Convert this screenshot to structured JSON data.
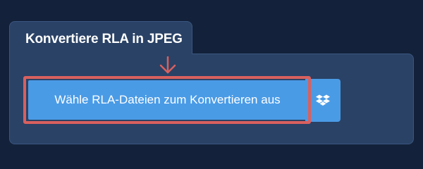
{
  "converter": {
    "tab_title": "Konvertiere RLA in JPEG",
    "choose_button_label": "Wähle RLA-Dateien zum Konvertieren aus",
    "dropbox_icon": "dropbox-icon",
    "highlight_arrow_icon": "arrow-down-icon"
  },
  "colors": {
    "background": "#13223a",
    "panel": "#2a4266",
    "button": "#4a9be6",
    "highlight": "#d9605e"
  }
}
